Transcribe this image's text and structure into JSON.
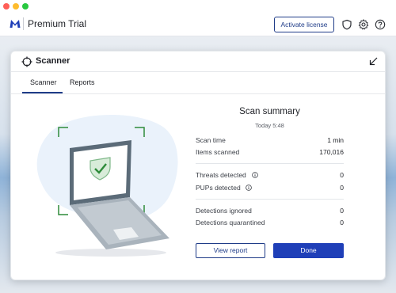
{
  "app": {
    "title": "Premium Trial",
    "activate_label": "Activate license",
    "brand_color": "#1f3fb8",
    "header_icons": [
      "shield-icon",
      "gear-icon",
      "help-icon"
    ]
  },
  "dialog": {
    "title": "Scanner",
    "tabs": [
      {
        "label": "Scanner",
        "active": true
      },
      {
        "label": "Reports",
        "active": false
      }
    ]
  },
  "summary": {
    "title": "Scan summary",
    "time": "Today 5:48",
    "rows": [
      {
        "label": "Scan time",
        "value": "1 min"
      },
      {
        "label": "Items scanned",
        "value": "170,016"
      },
      {
        "label": "Threats detected",
        "value": "0"
      },
      {
        "label": "PUPs detected",
        "value": "0"
      },
      {
        "label": "Detections ignored",
        "value": "0"
      },
      {
        "label": "Detections quarantined",
        "value": "0"
      }
    ]
  },
  "actions": {
    "view_report": "View report",
    "done": "Done"
  }
}
